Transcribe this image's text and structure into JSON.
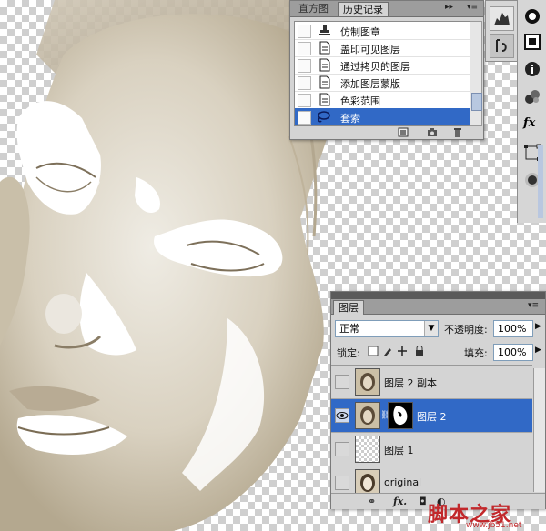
{
  "history_panel": {
    "tabs": [
      "直方图",
      "历史记录"
    ],
    "items": [
      {
        "label": "仿制图章",
        "icon": "stamp-icon",
        "selected": false
      },
      {
        "label": "盖印可见图层",
        "icon": "history-doc-icon",
        "selected": false
      },
      {
        "label": "通过拷贝的图层",
        "icon": "history-doc-icon",
        "selected": false
      },
      {
        "label": "添加图层蒙版",
        "icon": "history-doc-icon",
        "selected": false
      },
      {
        "label": "色彩范围",
        "icon": "history-doc-icon",
        "selected": false
      },
      {
        "label": "套索",
        "icon": "lasso-icon",
        "selected": true
      }
    ],
    "accent": "#3169c6"
  },
  "layers_panel": {
    "title": "图层",
    "blend_mode": "正常",
    "opacity_label": "不透明度:",
    "opacity_value": "100%",
    "lock_label": "锁定:",
    "fill_label": "填充:",
    "fill_value": "100%",
    "layers": [
      {
        "name": "图层 2 副本",
        "visible": false,
        "selected": false,
        "mask": false
      },
      {
        "name": "图层 2",
        "visible": true,
        "selected": true,
        "mask": true
      },
      {
        "name": "图层 1",
        "visible": false,
        "selected": false,
        "mask": false
      },
      {
        "name": "original",
        "visible": false,
        "selected": false,
        "mask": false
      }
    ],
    "footer_fx": "fx."
  },
  "watermark": {
    "text": "脚本之家",
    "url": "www.jb51.net"
  }
}
